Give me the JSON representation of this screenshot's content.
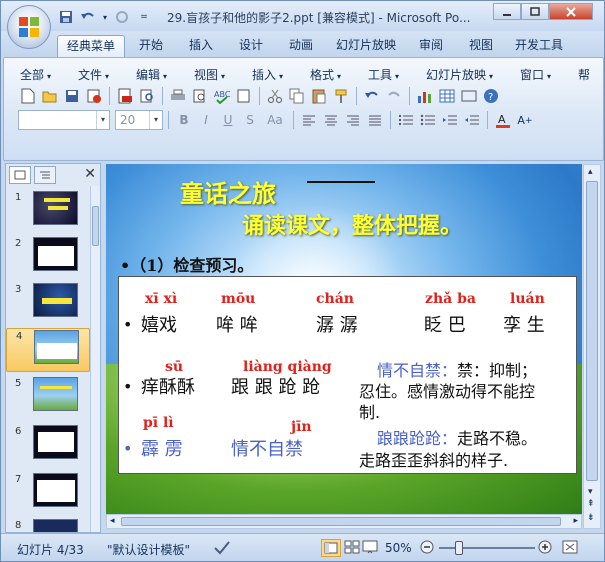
{
  "window": {
    "title": "29.盲孩子和他的影子2.ppt [兼容模式] - Microsoft Po...",
    "controls": [
      "minimize",
      "maximize",
      "close"
    ]
  },
  "ribbon_tabs": [
    "经典菜单",
    "开始",
    "插入",
    "设计",
    "动画",
    "幻灯片放映",
    "审阅",
    "视图",
    "开发工具"
  ],
  "menu": [
    "全部",
    "文件",
    "编辑",
    "视图",
    "插入",
    "格式",
    "工具",
    "幻灯片放映",
    "窗口",
    "帮"
  ],
  "font": {
    "name": "",
    "size": "20"
  },
  "slides_pane": {
    "numbers": [
      "1",
      "2",
      "3",
      "4",
      "5",
      "6",
      "7",
      "8"
    ],
    "selected": "4"
  },
  "slide": {
    "title1": "童话之旅",
    "title2": "诵读课文，整体把握。",
    "bullet": "•（1）检查预习。",
    "rows": [
      {
        "words": [
          {
            "py": "xī xì",
            "hz": "嬉戏"
          },
          {
            "py": "mōu",
            "hz": "哞 哞"
          },
          {
            "py": "chán",
            "hz": "潺 潺"
          },
          {
            "py": "zhǎ  ba",
            "hz": "眨 巴"
          },
          {
            "py": "luán",
            "hz": "孪 生"
          }
        ]
      },
      {
        "words": [
          {
            "py": "sū",
            "hz": "痒酥酥"
          },
          {
            "py": "liàng qiàng",
            "hz": "跟 跟 跄 跄"
          }
        ],
        "def_term": "情不自禁：",
        "def_text1": "禁：抑制；",
        "def_text2": "忍住。感情激动得不能控",
        "def_text3": "制."
      },
      {
        "words": [
          {
            "py": "pī  lì",
            "hz": "霹 雳"
          },
          {
            "py": "jīn",
            "hz": "情不自禁"
          }
        ],
        "def_term": "踉踉跄跄：",
        "def_text1": "走路不稳。",
        "def_text2": "走路歪歪斜斜的样子."
      }
    ]
  },
  "statusbar": {
    "slide_info": "幻灯片 4/33",
    "theme": "\"默认设计模板\"",
    "zoom": "50%"
  },
  "colors": {
    "accent": "#4a62c6",
    "pinyin": "#e0211c",
    "title": "#ffff33"
  }
}
